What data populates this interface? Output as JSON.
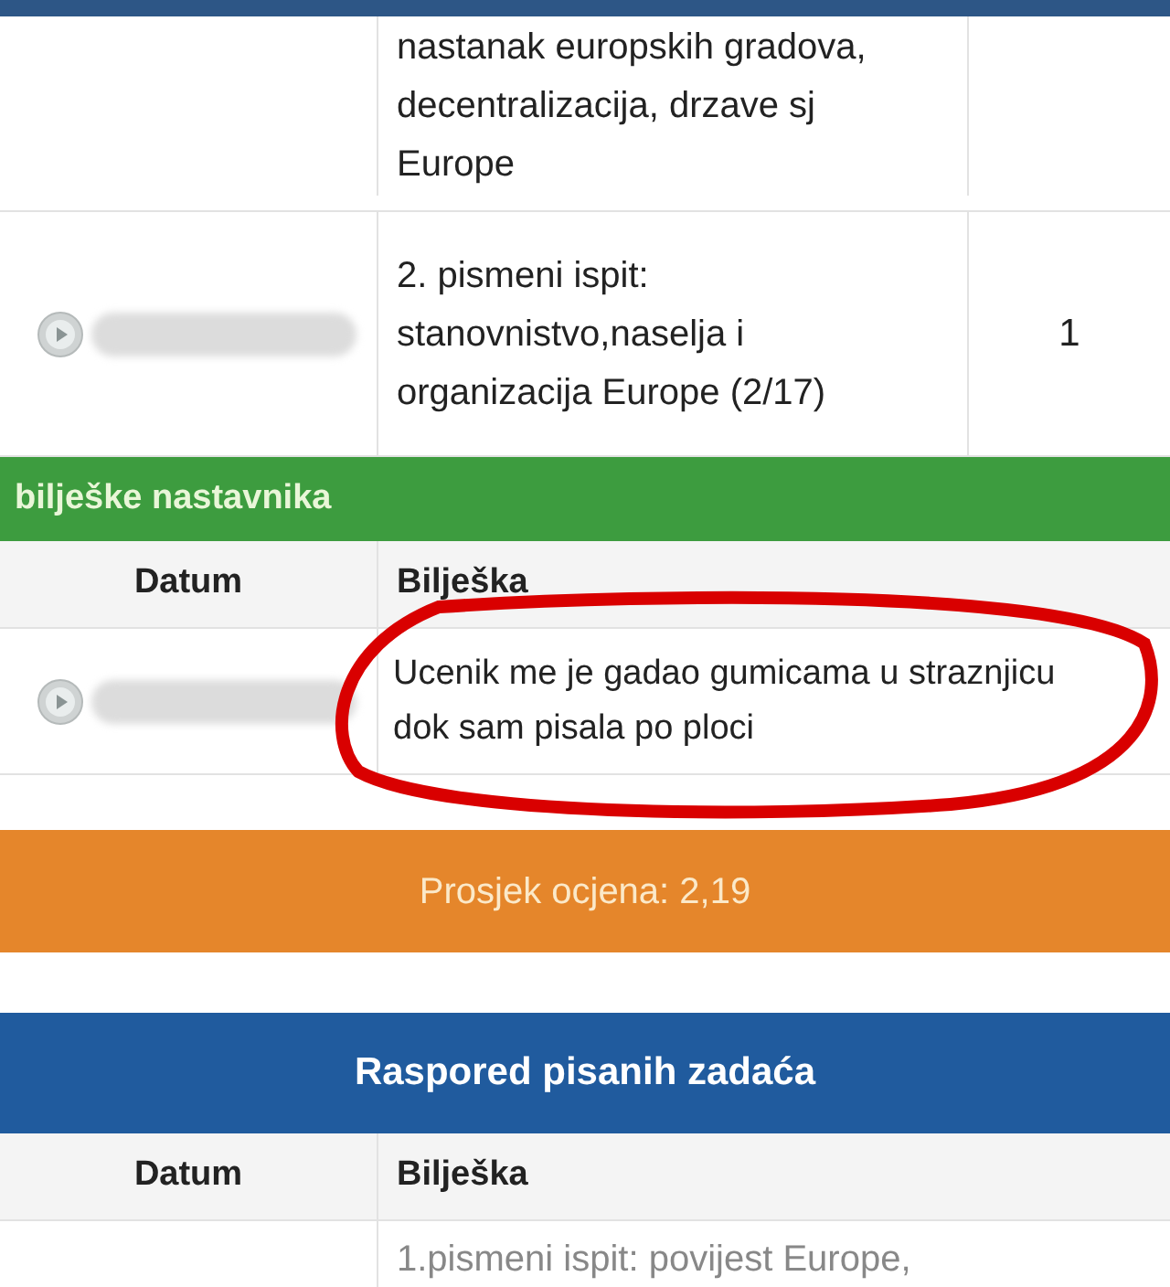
{
  "grades_table": {
    "rows": [
      {
        "date_redacted": false,
        "note": "nastanak europskih gradova, decentralizacija, drzave sj Europe",
        "count": ""
      },
      {
        "date_redacted": true,
        "note": "2. pismeni ispit: stanovnistvo,naselja i organizacija Europe (2/17)",
        "count": "1"
      }
    ]
  },
  "teacher_notes": {
    "title": "bilješke nastavnika",
    "columns": [
      "Datum",
      "Bilješka"
    ],
    "rows": [
      {
        "date_redacted": true,
        "note": "Ucenik me je gadao gumicama u straznjicu dok sam pisala po ploci",
        "circled": true
      }
    ]
  },
  "average": {
    "text": "Prosjek ocjena: 2,19"
  },
  "exam_schedule": {
    "title": "Raspored pisanih zadaća",
    "columns": [
      "Datum",
      "Bilješka"
    ],
    "rows": [
      {
        "note": "1.pismeni ispit: povijest Europe,"
      }
    ]
  }
}
